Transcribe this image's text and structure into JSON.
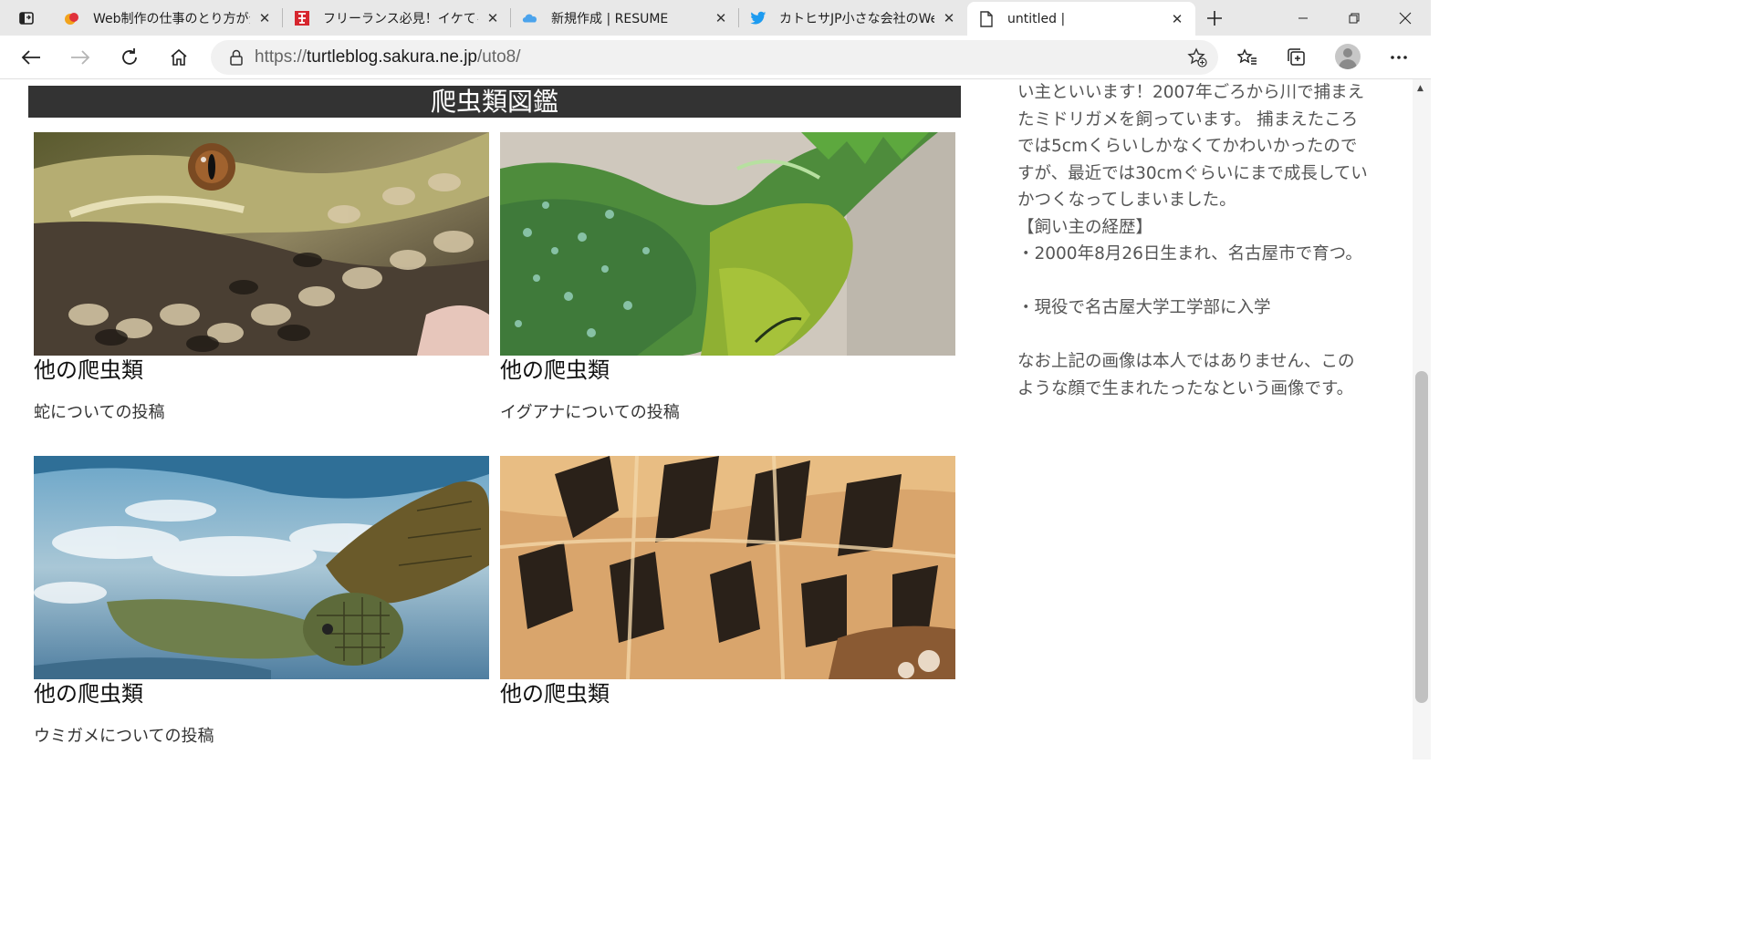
{
  "browser": {
    "tabs": [
      {
        "title": "Web制作の仕事のとり方が分",
        "icon": "app-logo-icon",
        "active": false
      },
      {
        "title": "フリーランス必見！イケてるポー",
        "icon": "red-badge-icon",
        "active": false
      },
      {
        "title": "新規作成 | RESUME",
        "icon": "cloud-icon",
        "active": false
      },
      {
        "title": "カトヒサJP小さな会社のWeb",
        "icon": "twitter-bird-icon",
        "active": false
      },
      {
        "title": "untitled |",
        "icon": "page-icon",
        "active": true
      }
    ],
    "address": {
      "scheme": "https://",
      "host": "turtleblog.sakura.ne.jp",
      "path": "/uto8/"
    },
    "accent": "#1d9bf0"
  },
  "page": {
    "section_title": "爬虫類図鑑",
    "cards": [
      {
        "title": "他の爬虫類",
        "desc": "蛇についての投稿",
        "image": "snake"
      },
      {
        "title": "他の爬虫類",
        "desc": "イグアナについての投稿",
        "image": "iguana"
      },
      {
        "title": "他の爬虫類",
        "desc": "ウミガメについての投稿",
        "image": "sea-turtle"
      },
      {
        "title": "他の爬虫類",
        "desc": "",
        "image": "tortoise"
      }
    ],
    "sidebar": {
      "lines": [
        "い主といいます！2007年ごろから川で捕まえ",
        "たミドリガメを飼っています。 捕まえたころ",
        "では5cmくらいしかなくてかわいかったので",
        "すが、最近では30cmぐらいにまで成長してい",
        "かつくなってしまいました。",
        "【飼い主の経歴】",
        "・2000年8月26日生まれ、名古屋市で育つ。",
        "",
        "・現役で名古屋大学工学部に入学",
        "",
        "なお上記の画像は本人ではありません、この",
        "ような顔で生まれたったなという画像です。"
      ]
    },
    "header_bg": "#333333"
  }
}
